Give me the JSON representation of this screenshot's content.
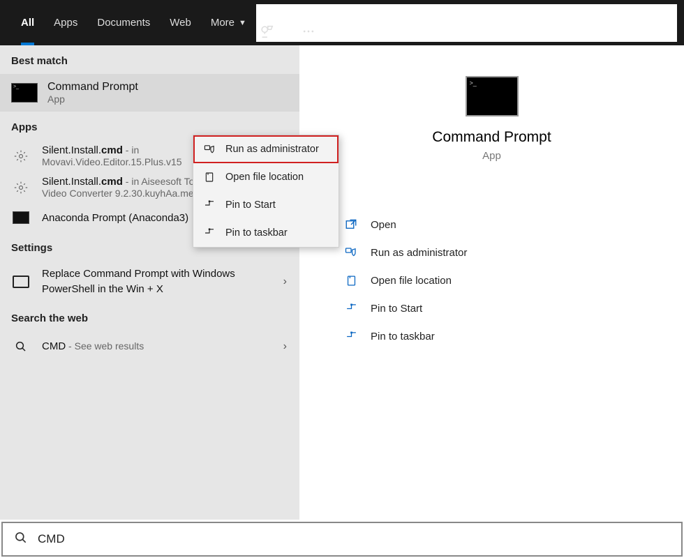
{
  "topbar": {
    "tabs": [
      "All",
      "Apps",
      "Documents",
      "Web",
      "More"
    ]
  },
  "left": {
    "best_match_header": "Best match",
    "best_match": {
      "title": "Command Prompt",
      "subtitle": "App"
    },
    "apps_header": "Apps",
    "apps": [
      {
        "title_pre": "Silent.Install.",
        "title_bold": "cmd",
        "suffix": " - in",
        "sub": "Movavi.Video.Editor.15.Plus.v15"
      },
      {
        "title_pre": "Silent.Install.",
        "title_bold": "cmd",
        "suffix": " - in Aiseesoft Total",
        "sub": "Video Converter 9.2.30.kuyhAa.me"
      },
      {
        "title_pre": "Anaconda Prompt (Anaconda3)",
        "title_bold": "",
        "suffix": "",
        "sub": ""
      }
    ],
    "settings_header": "Settings",
    "settings": {
      "line": "Replace Command Prompt with Windows PowerShell in the Win + X"
    },
    "web_header": "Search the web",
    "web": {
      "title": "CMD",
      "suffix": " - See web results"
    }
  },
  "context_menu": {
    "items": [
      "Run as administrator",
      "Open file location",
      "Pin to Start",
      "Pin to taskbar"
    ]
  },
  "preview": {
    "title": "Command Prompt",
    "subtitle": "App",
    "actions": [
      "Open",
      "Run as administrator",
      "Open file location",
      "Pin to Start",
      "Pin to taskbar"
    ]
  },
  "search": {
    "query": "CMD"
  }
}
